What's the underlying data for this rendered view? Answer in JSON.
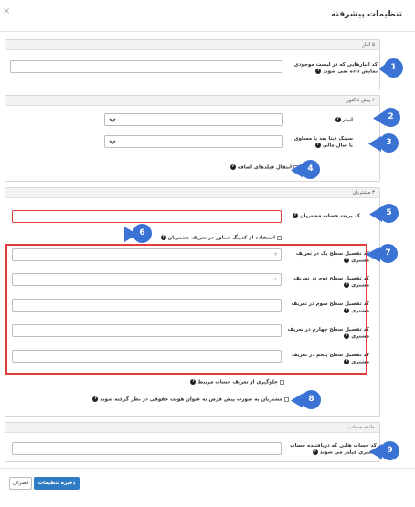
{
  "modal": {
    "title": "تنظیمات پیشرفته",
    "close_glyph": "×"
  },
  "sections": {
    "warehouse": {
      "header": "۵ انبار",
      "hidden_warehouses_label": "کد انبارهایی که در لیست موجودی نمایش داده نمی شوند",
      "hidden_warehouses_value": ""
    },
    "invoice": {
      "header": "۶ پیش فاکتور",
      "warehouse_label": "انبار",
      "warehouse_value": "",
      "sync_label": "سینک دیتا بعد یا مساوی با سال مالی",
      "sync_value": "",
      "transfer_extra_fields_label": "انتقال فیلدهای اضافه"
    },
    "customers": {
      "header": "۳ مشتریان",
      "parent_account_label": "کد پرنت حساب مشتریان",
      "parent_account_value": "",
      "floating_code_label": "استفاده از کدینگ شناور در تعریف مشتریان",
      "levels": [
        {
          "label": "کد تفصیل سطح یک در تعریف مشتری",
          "value": "۰۰۲"
        },
        {
          "label": "کد تفصیل سطح دوم در تعریف مشتری",
          "value": "۰۰۱"
        },
        {
          "label": "کد تفصیل سطح سوم در تعریف مشتری",
          "value": ""
        },
        {
          "label": "کد تفصیل سطح چهارم در تعریف مشتری",
          "value": ""
        },
        {
          "label": "کد تفصیل سطح پنجم در تعریف مشتری",
          "value": ""
        }
      ],
      "prevent_related_account_label": "جلوگیری از تعریف حساب مرتبط",
      "default_legal_label": "مشتریان به صورت پیش فرض به عنوان هویت حقوقی در نظر گرفته شوند"
    },
    "balance": {
      "header": "مانده حساب",
      "accounts_label": "کد حساب هایی که دریافتنده حساب مشتری فیلتر می شوند",
      "accounts_value": ""
    }
  },
  "footer": {
    "save_label": "ذخیره تنظیمات",
    "cancel_label": "انصراف"
  },
  "badges": [
    "1",
    "2",
    "3",
    "4",
    "5",
    "6",
    "7",
    "8",
    "9"
  ],
  "info_glyph": "?",
  "colors": {
    "accent_blue": "#3b73d4",
    "save_button": "#2f7bc4",
    "highlight_red": "#e23c3c"
  }
}
